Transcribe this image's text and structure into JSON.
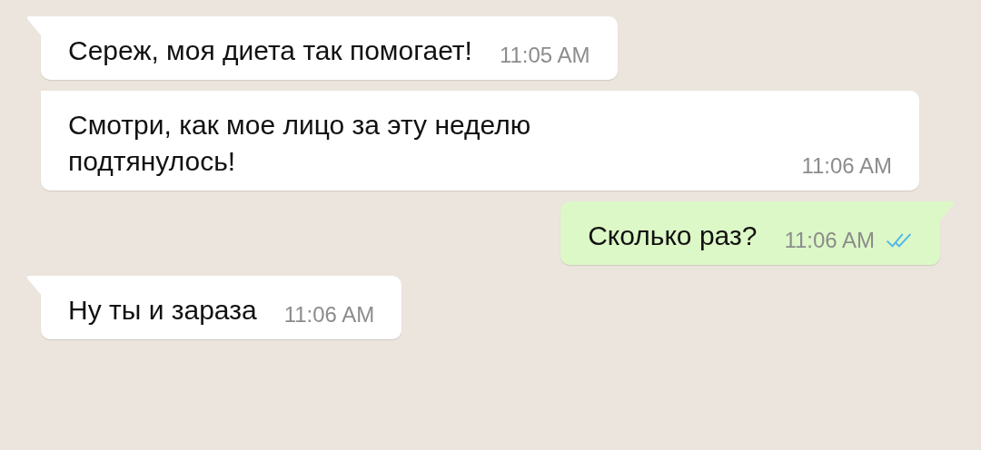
{
  "messages": [
    {
      "kind": "incoming",
      "tail": true,
      "text": "Сереж, моя диета так помогает!",
      "time": "11:05 AM"
    },
    {
      "kind": "incoming",
      "tail": false,
      "text": "Смотри, как мое лицо за эту неделю\nподтянулось!",
      "time": "11:06 AM"
    },
    {
      "kind": "outgoing",
      "tail": true,
      "text": "Сколько раз?",
      "time": "11:06 AM",
      "read": true
    },
    {
      "kind": "incoming",
      "tail": true,
      "text": "Ну ты и зараза",
      "time": "11:06 AM"
    }
  ]
}
